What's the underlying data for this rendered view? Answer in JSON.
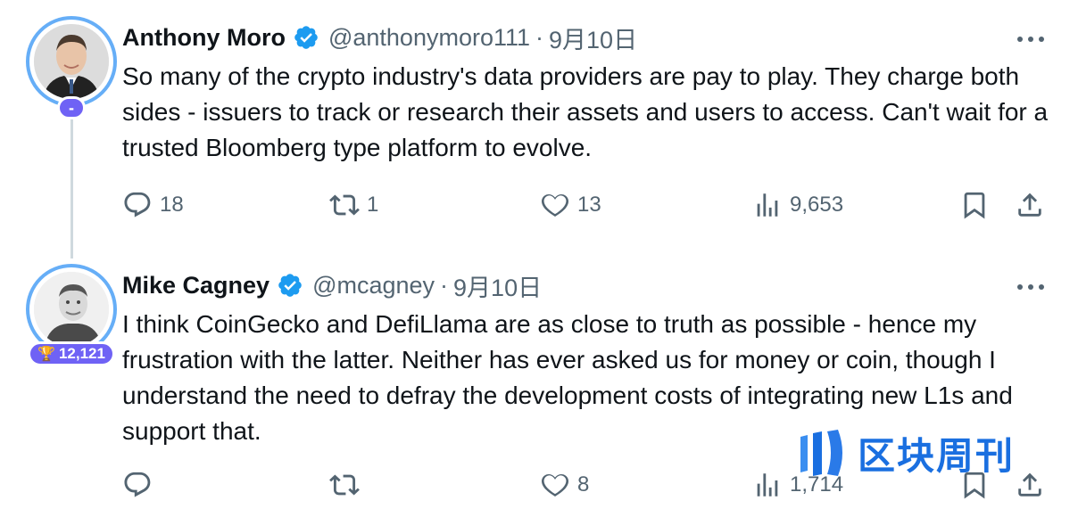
{
  "tweets": [
    {
      "name": "Anthony Moro",
      "handle": "@anthonymoro111",
      "separator": "·",
      "date": "9月10日",
      "badge": "-",
      "text": "So many of the crypto industry's data providers are pay to play.  They charge both sides - issuers to track or research their assets and users to access.  Can't wait for a trusted Bloomberg type platform to evolve.",
      "replies": "18",
      "retweets": "1",
      "likes": "13",
      "views": "9,653"
    },
    {
      "name": "Mike Cagney",
      "handle": "@mcagney",
      "separator": "·",
      "date": "9月10日",
      "badge": "12,121",
      "text": "I think CoinGecko and DefiLlama are as close to truth as possible - hence my frustration with the latter. Neither has ever asked us for money or coin, though I understand the need to defray the development costs of integrating new L1s and support that.",
      "replies": "",
      "retweets": "",
      "likes": "8",
      "views": "1,714"
    }
  ],
  "watermark": {
    "text": "区块周刊"
  },
  "icons": {
    "verified": "verified-badge-icon",
    "more": "more-horizontal-icon",
    "reply": "reply-icon",
    "retweet": "retweet-icon",
    "like": "heart-icon",
    "views": "views-icon",
    "bookmark": "bookmark-icon",
    "share": "share-icon",
    "trophy": "trophy-icon"
  },
  "colors": {
    "verified": "#1d9bf0",
    "badge": "#6f62f5",
    "ring": "#66aef7",
    "muted": "#536471",
    "watermark": "#1a6fe0"
  }
}
